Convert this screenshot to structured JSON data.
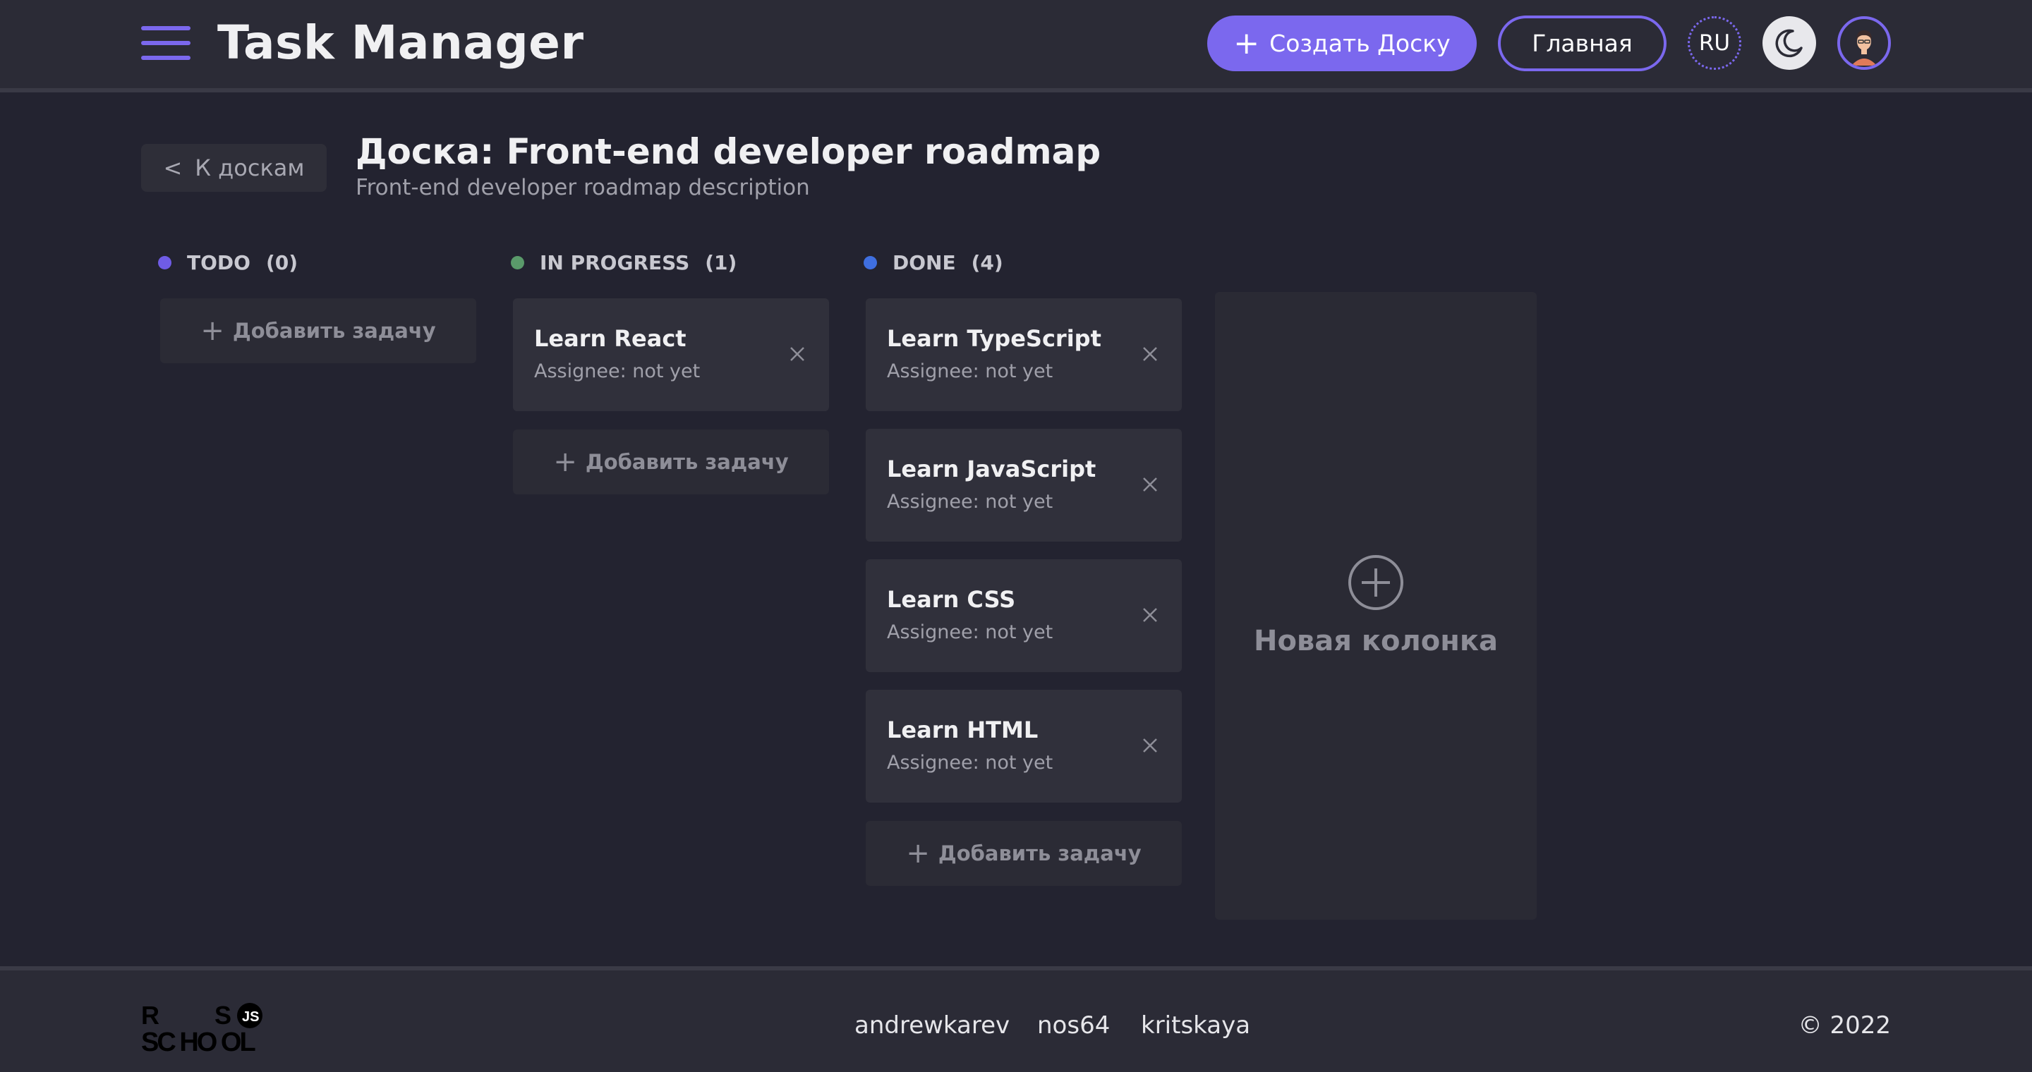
{
  "header": {
    "menu_icon": "hamburger-icon",
    "title": "Task Manager",
    "create_board_label": "Создать Доску",
    "home_label": "Главная",
    "lang_label": "RU",
    "theme_icon": "moon-icon",
    "avatar_icon": "user-avatar",
    "accent_color": "#7b68ee"
  },
  "board": {
    "back_label": "К доскам",
    "title": "Доска: Front-end developer roadmap",
    "description": "Front-end developer roadmap description"
  },
  "columns": [
    {
      "name": "TODO",
      "count": "(0)",
      "dot_color": "#6f5ce6",
      "tasks": [],
      "add_label": "Добавить задачу"
    },
    {
      "name": "IN PROGRESS",
      "count": "(1)",
      "dot_color": "#5a9a6a",
      "tasks": [
        {
          "title": "Learn React",
          "assignee": "Assignee: not yet"
        }
      ],
      "add_label": "Добавить задачу"
    },
    {
      "name": "DONE",
      "count": "(4)",
      "dot_color": "#3f6fe0",
      "tasks": [
        {
          "title": "Learn TypeScript",
          "assignee": "Assignee: not yet"
        },
        {
          "title": "Learn JavaScript",
          "assignee": "Assignee: not yet"
        },
        {
          "title": "Learn CSS",
          "assignee": "Assignee: not yet"
        },
        {
          "title": "Learn HTML",
          "assignee": "Assignee: not yet"
        }
      ],
      "add_label": "Добавить задачу"
    }
  ],
  "new_column": {
    "label": "Новая колонка",
    "icon": "plus-circle-icon"
  },
  "footer": {
    "logo": "RS SCHOOL JS",
    "links": [
      "andrewkarev",
      "nos64",
      "kritskaya"
    ],
    "copyright": "© 2022"
  }
}
